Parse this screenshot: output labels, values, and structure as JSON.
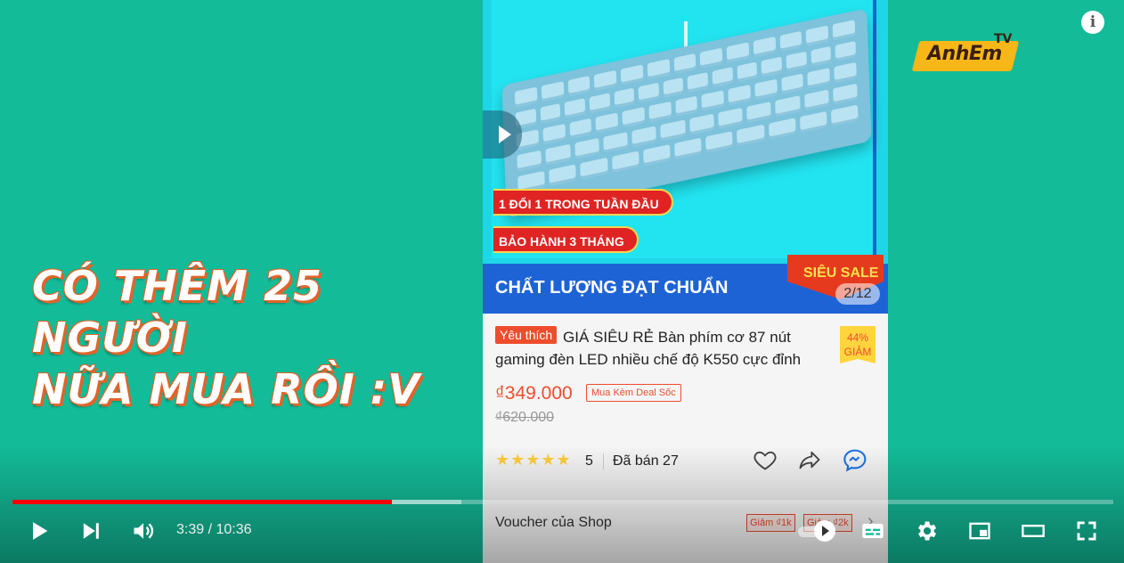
{
  "player": {
    "current_time": "3:39",
    "duration": "10:36",
    "time_display": "3:39 / 10:36",
    "played_fraction": 0.345,
    "loaded_fraction": 0.408,
    "colors": {
      "background": "#13bb98",
      "progress_played": "#ff0000"
    }
  },
  "overlay": {
    "caption_line_1": "CÓ THÊM 25 NGƯỜI",
    "caption_line_2": "NỮA MUA RỒI :V",
    "logo_main": "AnhEm",
    "logo_tv": "TV"
  },
  "product": {
    "promo_tag_1": "1 ĐỔI 1 TRONG TUẦN ĐẦU",
    "promo_tag_2": "BẢO HÀNH 3 THÁNG",
    "banner_text": "CHẤT LƯỢNG ĐẠT CHUẨN",
    "sale_badge": "SIÊU SALE",
    "image_counter": "2/12",
    "favorite_badge": "Yêu thích",
    "title": "GIÁ SIÊU RẺ Bàn phím cơ 87 nút gaming đèn LED nhiều chế độ K550 cực đỉnh",
    "discount_percent": "44%",
    "discount_label": "GIẢM",
    "price": "₫349.000",
    "deal_label": "Mua Kèm Deal Sốc",
    "old_price": "₫620.000",
    "stars": "★★★★★",
    "rating": "5",
    "sold": "Đã bán 27",
    "voucher_label": "Voucher của Shop",
    "voucher_chip_1": "Giảm ₫1k",
    "voucher_chip_2": "Giảm ₫2k",
    "colors": {
      "accent": "#ee4d2d",
      "banner": "#1e63d6",
      "image_bg": "#1fd6e8"
    }
  },
  "icons": {
    "play": "play-icon",
    "next": "next-icon",
    "volume": "volume-icon",
    "settings": "gear-icon",
    "subtitles": "subtitles-icon",
    "miniplayer": "miniplayer-icon",
    "theater": "theater-icon",
    "fullscreen": "fullscreen-icon",
    "info": "info-icon"
  }
}
